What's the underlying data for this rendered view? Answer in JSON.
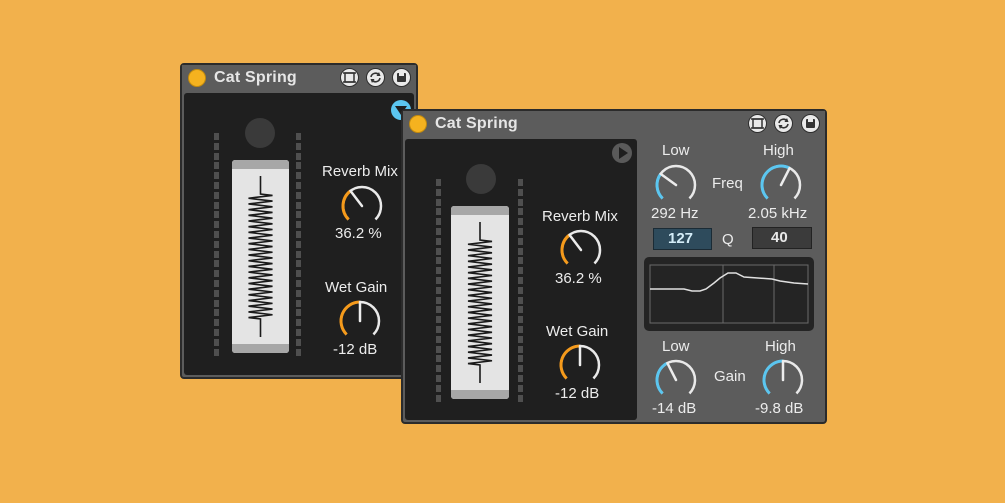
{
  "colors": {
    "background": "#f2b14c",
    "device_body": "#5c5c5c",
    "panel": "#1f1f1f",
    "accent_orange": "#f59a1b",
    "accent_blue": "#5bc6f0",
    "power_on": "#f5b21f"
  },
  "small_device": {
    "title": "Cat Spring",
    "icons": [
      "minimize-icon",
      "refresh-icon",
      "save-icon"
    ],
    "collapse_icon": "triangle-down-icon",
    "reverb_mix": {
      "label": "Reverb Mix",
      "value": "36.2 %",
      "level": 0.362
    },
    "wet_gain": {
      "label": "Wet Gain",
      "value": "-12 dB",
      "level": 0.5
    }
  },
  "large_device": {
    "title": "Cat Spring",
    "icons": [
      "minimize-icon",
      "refresh-icon",
      "save-icon"
    ],
    "expand_icon": "triangle-right-icon",
    "reverb_mix": {
      "label": "Reverb Mix",
      "value": "36.2 %",
      "level": 0.362
    },
    "wet_gain": {
      "label": "Wet Gain",
      "value": "-12 dB",
      "level": 0.5
    },
    "freq": {
      "label": "Freq",
      "low": {
        "label": "Low",
        "value": "292 Hz",
        "level": 0.3
      },
      "high": {
        "label": "High",
        "value": "2.05 kHz",
        "level": 0.6
      }
    },
    "q": {
      "label": "Q",
      "low_value": "127",
      "high_value": "40"
    },
    "gain": {
      "label": "Gain",
      "low": {
        "label": "Low",
        "value": "-14 dB",
        "level": 0.4
      },
      "high": {
        "label": "High",
        "value": "-9.8 dB",
        "level": 0.5
      }
    }
  }
}
